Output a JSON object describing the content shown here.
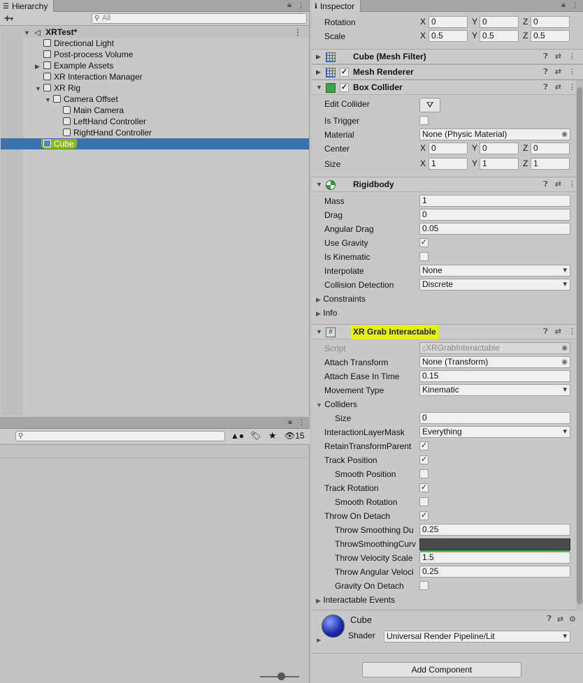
{
  "hierarchy": {
    "tab_label": "Hierarchy",
    "search_placeholder": "All",
    "scene": "XRTest*",
    "items": [
      {
        "label": "Directional Light"
      },
      {
        "label": "Post-process Volume"
      },
      {
        "label": "Example Assets"
      },
      {
        "label": "XR Interaction Manager"
      },
      {
        "label": "XR Rig"
      },
      {
        "label": "Camera Offset"
      },
      {
        "label": "Main Camera"
      },
      {
        "label": "LeftHand Controller"
      },
      {
        "label": "RightHand Controller"
      },
      {
        "label": "Cube"
      }
    ]
  },
  "project": {
    "search_placeholder": "",
    "hidden_count": "15"
  },
  "inspector": {
    "tab_label": "Inspector",
    "transform": {
      "rotation_label": "Rotation",
      "rotation": {
        "x": "0",
        "y": "0",
        "z": "0"
      },
      "scale_label": "Scale",
      "scale": {
        "x": "0.5",
        "y": "0.5",
        "z": "0.5"
      }
    },
    "axis": {
      "x": "X",
      "y": "Y",
      "z": "Z"
    },
    "mesh_filter": {
      "title": "Cube (Mesh Filter)"
    },
    "mesh_renderer": {
      "title": "Mesh Renderer"
    },
    "box_collider": {
      "title": "Box Collider",
      "edit_collider": "Edit Collider",
      "is_trigger": "Is Trigger",
      "material_label": "Material",
      "material": "None (Physic Material)",
      "center_label": "Center",
      "center": {
        "x": "0",
        "y": "0",
        "z": "0"
      },
      "size_label": "Size",
      "size": {
        "x": "1",
        "y": "1",
        "z": "1"
      }
    },
    "rigidbody": {
      "title": "Rigidbody",
      "mass_label": "Mass",
      "mass": "1",
      "drag_label": "Drag",
      "drag": "0",
      "angular_drag_label": "Angular Drag",
      "angular_drag": "0.05",
      "use_gravity": "Use Gravity",
      "is_kinematic": "Is Kinematic",
      "interpolate_label": "Interpolate",
      "interpolate": "None",
      "collision_label": "Collision Detection",
      "collision": "Discrete",
      "constraints": "Constraints",
      "info": "Info"
    },
    "grab": {
      "title": "XR Grab Interactable",
      "script_label": "Script",
      "script": "XRGrabInteractable",
      "attach_transform_label": "Attach Transform",
      "attach_transform": "None (Transform)",
      "attach_ease_label": "Attach Ease In Time",
      "attach_ease": "0.15",
      "movement_label": "Movement Type",
      "movement": "Kinematic",
      "colliders": "Colliders",
      "colliders_size_label": "Size",
      "colliders_size": "0",
      "layer_mask_label": "InteractionLayerMask",
      "layer_mask": "Everything",
      "retain_parent": "RetainTransformParent",
      "track_position": "Track Position",
      "smooth_position": "Smooth Position",
      "track_rotation": "Track Rotation",
      "smooth_rotation": "Smooth Rotation",
      "throw_on_detach": "Throw On Detach",
      "throw_smoothing_du_label": "Throw Smoothing Du",
      "throw_smoothing_du": "0.25",
      "throw_smoothing_curve_label": "ThrowSmoothingCurv",
      "throw_velocity_label": "Throw Velocity Scale",
      "throw_velocity": "1.5",
      "throw_angular_label": "Throw Angular Veloci",
      "throw_angular": "0.25",
      "gravity_on_detach": "Gravity On Detach",
      "interactable_events": "Interactable Events"
    },
    "material": {
      "name": "Cube",
      "shader_label": "Shader",
      "shader": "Universal Render Pipeline/Lit"
    },
    "add_component": "Add Component"
  },
  "colors": {
    "selection": "#3a72b0",
    "highlight": "#e6f20a"
  }
}
